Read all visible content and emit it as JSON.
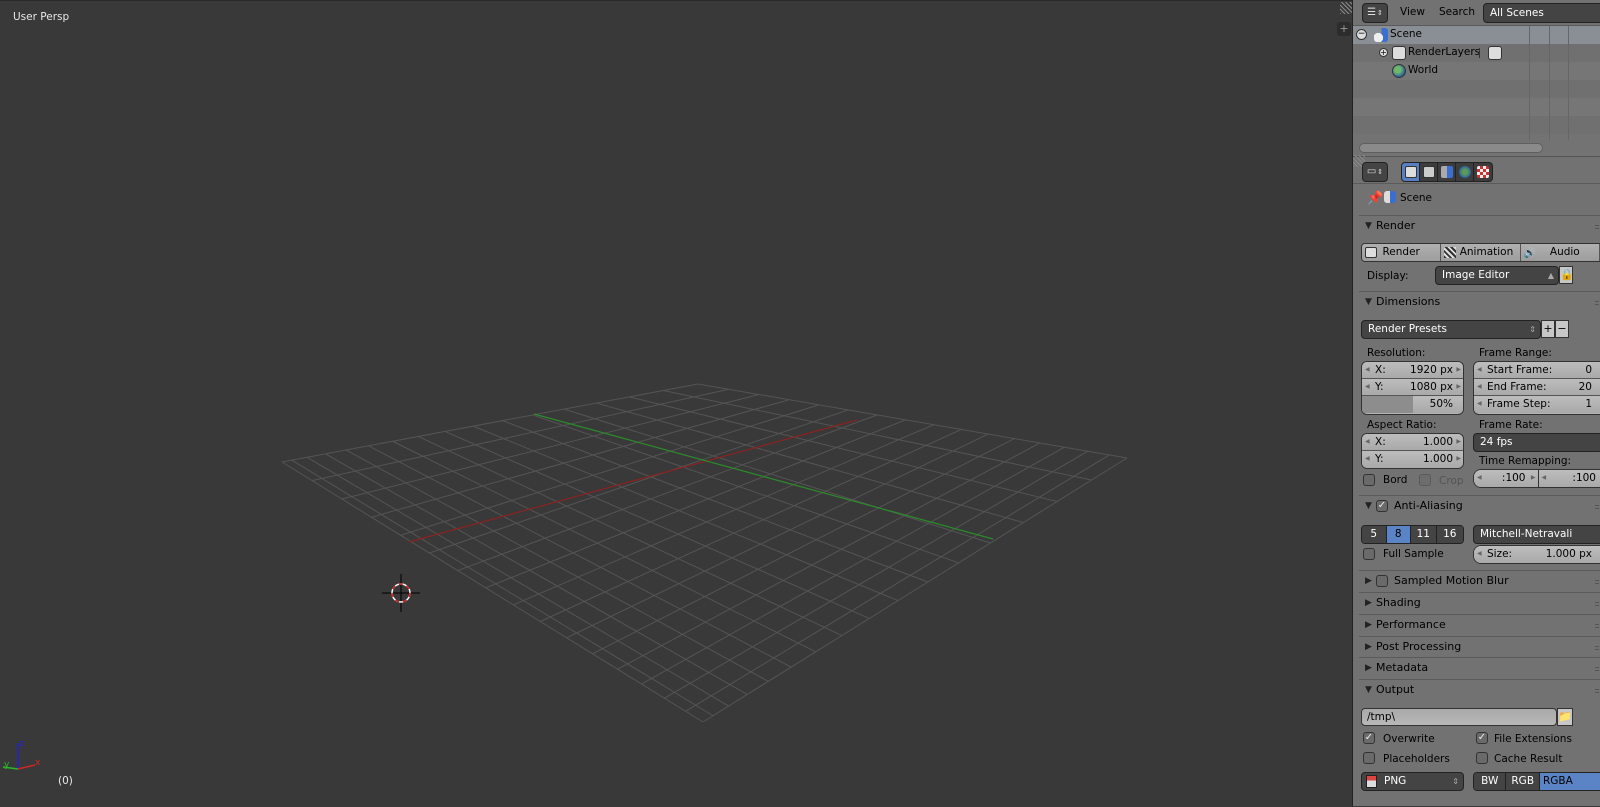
{
  "viewport": {
    "view_label": "User Persp",
    "frame_label": "(0)",
    "axes": {
      "x": "x",
      "y": "y",
      "z": "z"
    },
    "colors": {
      "background": "#393939",
      "grid": "#545454",
      "x_axis": "#8b2222",
      "y_axis": "#2b8b2b",
      "z_axis": "#2b2bcc"
    }
  },
  "outliner": {
    "editor_type_icon": "outliner-icon",
    "menu": [
      "View",
      "Search"
    ],
    "filter_dropdown": "All Scenes",
    "items": [
      {
        "label": "Scene",
        "icon": "scene-icon",
        "expand": "collapse",
        "selected": true
      },
      {
        "label": "RenderLayers",
        "icon": "render-layers-icon",
        "expand": "expand",
        "selected": false
      },
      {
        "label": "World",
        "icon": "world-icon",
        "expand": null,
        "selected": false
      }
    ]
  },
  "properties": {
    "editor_type_icon": "properties-icon",
    "context_tabs": [
      {
        "name": "render",
        "active": true
      },
      {
        "name": "render-layers",
        "active": false
      },
      {
        "name": "scene",
        "active": false
      },
      {
        "name": "world",
        "active": false
      },
      {
        "name": "texture",
        "active": false
      }
    ],
    "breadcrumb": "Scene",
    "render": {
      "title": "Render",
      "buttons": [
        "Render",
        "Animation",
        "Audio"
      ],
      "display_label": "Display:",
      "display_value": "Image Editor"
    },
    "dimensions": {
      "title": "Dimensions",
      "presets": "Render Presets",
      "resolution_label": "Resolution:",
      "res_x_key": "X:",
      "res_x": "1920 px",
      "res_y_key": "Y:",
      "res_y": "1080 px",
      "res_pct": "50%",
      "res_pct_value": 0.5,
      "frame_range_label": "Frame Range:",
      "start_key": "Start Frame:",
      "start": "0",
      "end_key": "End Frame:",
      "end": "20",
      "step_key": "Frame Step:",
      "step": "1",
      "aspect_label": "Aspect Ratio:",
      "asp_x_key": "X:",
      "asp_x": "1.000",
      "asp_y_key": "Y:",
      "asp_y": "1.000",
      "frame_rate_label": "Frame Rate:",
      "frame_rate": "24 fps",
      "time_remap_label": "Time Remapping:",
      "remap_old": ":100",
      "remap_new": ":100",
      "bord_label": "Bord",
      "bord_checked": false,
      "crop_label": "Crop",
      "crop_checked": false
    },
    "anti_aliasing": {
      "title": "Anti-Aliasing",
      "enabled": true,
      "samples": [
        "5",
        "8",
        "11",
        "16"
      ],
      "selected_sample": "8",
      "filter": "Mitchell-Netravali",
      "full_sample_label": "Full Sample",
      "full_sample_checked": false,
      "size_key": "Size:",
      "size": "1.000 px"
    },
    "collapsed_panels": [
      {
        "title": "Sampled Motion Blur",
        "has_checkbox": true
      },
      {
        "title": "Shading"
      },
      {
        "title": "Performance"
      },
      {
        "title": "Post Processing"
      },
      {
        "title": "Metadata"
      }
    ],
    "output": {
      "title": "Output",
      "path": "/tmp\\",
      "overwrite_label": "Overwrite",
      "overwrite": true,
      "file_ext_label": "File Extensions",
      "file_ext": true,
      "placeholders_label": "Placeholders",
      "placeholders": false,
      "cache_label": "Cache Result",
      "cache": false,
      "format": "PNG",
      "color_modes": [
        "BW",
        "RGB",
        "RGBA"
      ],
      "color_mode_selected": "RGBA"
    }
  }
}
